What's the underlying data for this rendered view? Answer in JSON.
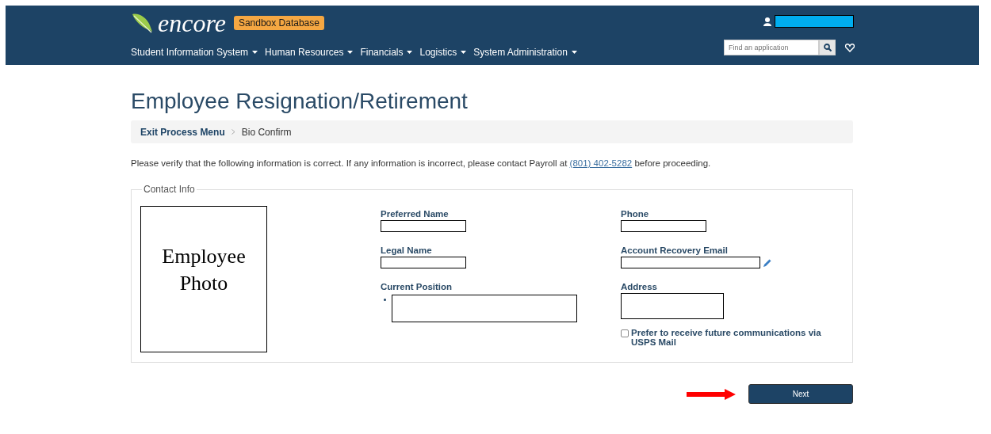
{
  "header": {
    "logo": "encore",
    "badge": "Sandbox Database",
    "nav": [
      {
        "label": "Student Information System"
      },
      {
        "label": "Human Resources"
      },
      {
        "label": "Financials"
      },
      {
        "label": "Logistics"
      },
      {
        "label": "System Administration"
      }
    ],
    "search": {
      "placeholder": "Find an application"
    }
  },
  "title": "Employee Resignation/Retirement",
  "breadcrumb": [
    {
      "label": "Exit Process Menu",
      "kind": "link"
    },
    {
      "label": "Bio Confirm",
      "kind": "current"
    }
  ],
  "notice": {
    "text": "Please verify that the following information is correct. If any information is incorrect, please contact Payroll at",
    "link": "(801) 402-5282",
    "after": "before proceeding."
  },
  "contact_info": {
    "legend": "Contact Info",
    "photo_label": "Employee Photo",
    "columns": [
      [
        {
          "label": "Preferred Name",
          "kind": "short"
        },
        {
          "label": "Legal Name",
          "kind": "short"
        },
        {
          "label": "Current Position",
          "kind": "bullet"
        }
      ],
      [
        {
          "label": "Phone",
          "kind": "short"
        },
        {
          "label": "Account Recovery Email",
          "kind": "editable"
        },
        {
          "label": "Address",
          "kind": "tall"
        }
      ]
    ],
    "mail_pref": {
      "label": "Prefer to receive future communications via USPS Mail",
      "checked": false
    }
  },
  "next_button": "Next"
}
